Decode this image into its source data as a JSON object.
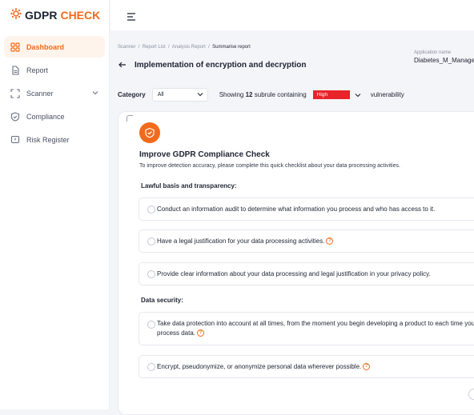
{
  "brand": {
    "name_part1": "GDPR",
    "name_part2": "CHECK"
  },
  "sidebar": {
    "items": [
      {
        "label": "Dashboard",
        "icon": "grid-icon"
      },
      {
        "label": "Report",
        "icon": "document-icon"
      },
      {
        "label": "Scanner",
        "icon": "scan-icon"
      },
      {
        "label": "Compliance",
        "icon": "shield-check-icon"
      },
      {
        "label": "Risk Register",
        "icon": "alert-icon"
      }
    ]
  },
  "breadcrumb": {
    "b1": "Scanner",
    "b2": "Report List",
    "b3": "Analysis Report",
    "current": "Summarise report"
  },
  "header": {
    "title": "Implementation of encryption and decryption",
    "app_label": "Application name",
    "app_value": "Diabetes_M_Managem"
  },
  "filters": {
    "category_label": "Category",
    "category_value": "All",
    "showing_prefix": "Showing",
    "count": "12",
    "showing_suffix": "subrule containing",
    "severity": "High",
    "vulnerability": "vulnerability"
  },
  "checklist": {
    "title": "Improve GDPR Compliance Check",
    "subtitle": "To improve detection accuracy, please complete this quick checklist about your data processing activities.",
    "section1": "Lawful basis and transparency:",
    "section2": "Data security:",
    "q1": "Conduct an information audit to determine what information you process and who has access to it.",
    "q2": "Have a legal justification for your data processing activities.",
    "q3": "Provide clear information about your data processing and legal justification in your privacy policy.",
    "q4": "Take data protection into account at all times, from the moment you begin developing a product to each time you process data.",
    "q5": "Encrypt, pseudonymize, or anonymize personal data wherever possible.",
    "help": "?"
  },
  "colors": {
    "accent": "#f26a1b",
    "danger": "#e8232a"
  }
}
